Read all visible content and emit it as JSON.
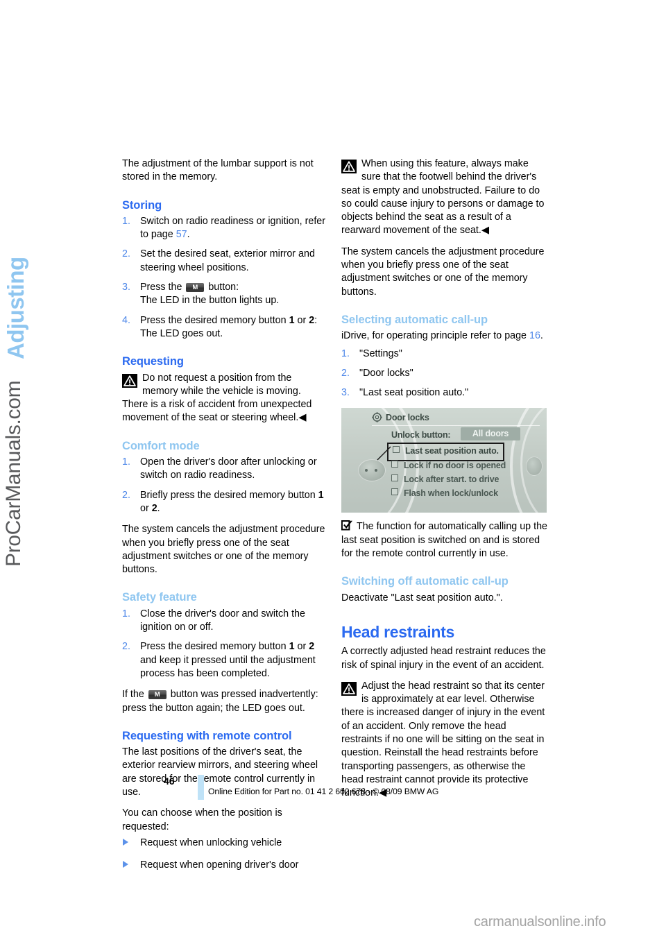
{
  "chapter": {
    "label": "Adjusting"
  },
  "watermarks": {
    "side": "ProCarManuals.com",
    "bottom": "carmanualsonline.info"
  },
  "colors": {
    "heading_blue": "#2b6af0",
    "heading_light_blue": "#8fc6f0",
    "list_number_blue": "#4c86e8",
    "footer_bar": "#bfe2f7"
  },
  "left_column": {
    "intro": "The adjustment of the lumbar support is not stored in the memory.",
    "storing": {
      "heading": "Storing",
      "steps": [
        {
          "num": "1.",
          "text_a": "Switch on radio readiness or ignition, refer to page ",
          "link": "57",
          "text_b": "."
        },
        {
          "num": "2.",
          "text_a": "Set the desired seat, exterior mirror and steering wheel positions."
        },
        {
          "num": "3.",
          "text_a": "Press the ",
          "button": "M",
          "text_b": " button:",
          "text_c": "The LED in the button lights up."
        },
        {
          "num": "4.",
          "text_a": "Press the desired memory button ",
          "bold1": "1",
          "text_b": " or ",
          "bold2": "2",
          "text_c": ":",
          "text_d": "The LED goes out."
        }
      ]
    },
    "requesting": {
      "heading": "Requesting",
      "warning": "Do not request a position from the memory while the vehicle is moving. There is a risk of accident from unexpected movement of the seat or steering wheel."
    },
    "comfort_mode": {
      "heading": "Comfort mode",
      "steps": [
        {
          "num": "1.",
          "text_a": "Open the driver's door after unlocking or switch on radio readiness."
        },
        {
          "num": "2.",
          "text_a": "Briefly press the desired memory button ",
          "bold1": "1",
          "text_b": " or ",
          "bold2": "2",
          "text_c": "."
        }
      ],
      "note": "The system cancels the adjustment procedure when you briefly press one of the seat adjustment switches or one of the memory buttons."
    },
    "safety_feature": {
      "heading": "Safety feature",
      "steps": [
        {
          "num": "1.",
          "text_a": "Close the driver's door and switch the ignition on or off."
        },
        {
          "num": "2.",
          "text_a": "Press the desired memory button ",
          "bold1": "1",
          "text_b": " or ",
          "bold2": "2",
          "text_c": " and keep it pressed until the adjustment process has been completed."
        }
      ],
      "note_a": "If the ",
      "note_button": "M",
      "note_b": " button was pressed inadvertently: press the button again; the LED goes out."
    },
    "remote_control": {
      "heading": "Requesting with remote control",
      "para1": "The last positions of the driver's seat, the exterior rearview mirrors, and steering wheel are stored for the remote control currently in use.",
      "para2": "You can choose when the position is requested:",
      "bullets": [
        "Request when unlocking vehicle",
        "Request when opening driver's door"
      ]
    }
  },
  "right_column": {
    "warning": "When using this feature, always make sure that the footwell behind the driver's seat is empty and unobstructed. Failure to do so could cause injury to persons or damage to objects behind the seat as a result of a rearward movement of the seat.",
    "cancel_note": "The system cancels the adjustment procedure when you briefly press one of the seat adjustment switches or one of the memory buttons.",
    "selecting": {
      "heading": "Selecting automatic call-up",
      "lead_a": "iDrive, for operating principle refer to page ",
      "lead_link": "16",
      "lead_b": ".",
      "steps": [
        {
          "num": "1.",
          "text_a": "\"Settings\""
        },
        {
          "num": "2.",
          "text_a": "\"Door locks\""
        },
        {
          "num": "3.",
          "text_a": "\"Last seat position auto.\""
        }
      ]
    },
    "idrive_screen": {
      "title": "Door locks",
      "unlock_label": "Unlock button:",
      "unlock_value": "All doors",
      "options": [
        {
          "label": "Last seat position auto.",
          "selected": true
        },
        {
          "label": "Lock if no door is opened",
          "selected": false
        },
        {
          "label": "Lock after start. to drive",
          "selected": false
        },
        {
          "label": "Flash when lock/unlock",
          "selected": false
        }
      ]
    },
    "check_note": "The function for automatically calling up the last seat position is switched on and is stored for the remote control currently in use.",
    "switching_off": {
      "heading": "Switching off automatic call-up",
      "text": "Deactivate \"Last seat position auto.\"."
    },
    "head_restraints": {
      "heading": "Head restraints",
      "intro": "A correctly adjusted head restraint reduces the risk of spinal injury in the event of an accident.",
      "warning": "Adjust the head restraint so that its center is approximately at ear level. Otherwise there is increased danger of injury in the event of an accident. Only remove the head restraints if no one will be sitting on the seat in question. Reinstall the head restraints before transporting passengers, as otherwise the head restraint cannot provide its protective function."
    }
  },
  "footer": {
    "page_number": "46",
    "legal": "Online Edition for Part no. 01 41 2 602 678 - © 08/09 BMW AG"
  }
}
